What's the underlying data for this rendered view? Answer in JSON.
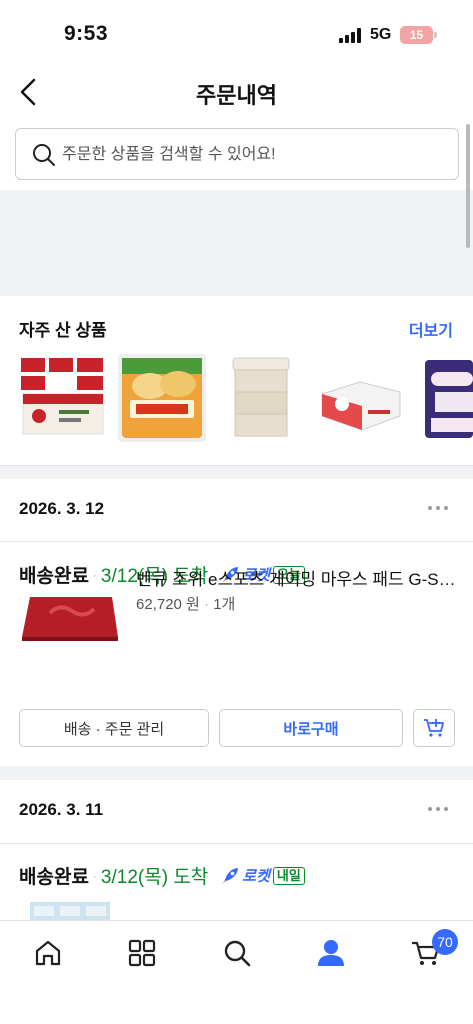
{
  "status_bar": {
    "time": "9:53",
    "network": "5G",
    "battery": "15"
  },
  "header": {
    "title": "주문내역"
  },
  "search": {
    "placeholder": "주문한 상품을 검색할 수 있어요!"
  },
  "frequent": {
    "title": "자주 산 상품",
    "more_label": "더보기",
    "thumbs": [
      "rice-pack",
      "garlic-bread",
      "tissue-pack",
      "product-box",
      "toilet-paper"
    ]
  },
  "orders": [
    {
      "date": "2026. 3. 12",
      "status": "배송완료",
      "arrival": "3/12(목) 도착",
      "rocket_label": "로켓",
      "rocket_badge": "오늘",
      "product_name": "벤큐 조위 e스포츠 게이밍 마우스 패드 G-SR-SE",
      "price": "62,720 원",
      "qty": "1개",
      "manage_label": "배송 · 주문 관리",
      "rebuy_label": "바로구매"
    },
    {
      "date": "2026. 3. 11",
      "status": "배송완료",
      "arrival": "3/12(목) 도착",
      "rocket_label": "로켓",
      "rocket_badge": "내일"
    }
  ],
  "tabbar": {
    "cart_count": "70"
  },
  "colors": {
    "accent": "#346aff",
    "arrival_green": "#0a8a2a",
    "battery": "#f2a3a3"
  }
}
